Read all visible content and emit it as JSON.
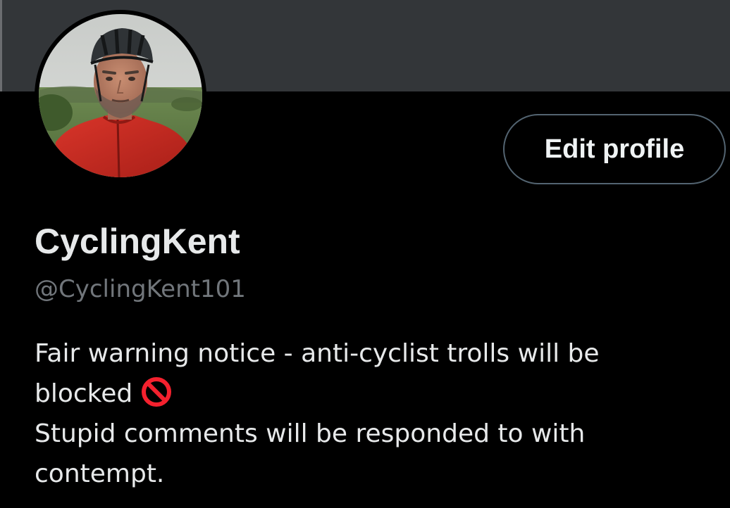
{
  "profile": {
    "display_name": "CyclingKent",
    "handle": "@CyclingKent101",
    "edit_button_label": "Edit profile",
    "bio": {
      "line1": "Fair warning notice - anti-cyclist trolls will be",
      "line2": "blocked",
      "line2_emoji": "prohibited-icon",
      "line3": "Stupid comments will be responded to with",
      "line4": "contempt."
    },
    "avatar": "avatar-photo-cyclist-in-helmet"
  },
  "colors": {
    "background": "#000000",
    "banner": "#333639",
    "primary_text": "#e7e9ea",
    "secondary_text": "#71767b",
    "button_border": "#536471",
    "prohibited_red": "#f4212e"
  }
}
